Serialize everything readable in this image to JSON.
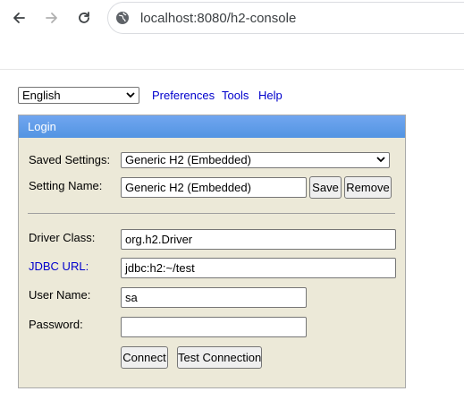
{
  "browser": {
    "url": "localhost:8080/h2-console"
  },
  "toolbar": {
    "language": "English",
    "links": [
      "Preferences",
      "Tools",
      "Help"
    ]
  },
  "login": {
    "title": "Login",
    "saved_settings_label": "Saved Settings:",
    "saved_settings_value": "Generic H2 (Embedded)",
    "setting_name_label": "Setting Name:",
    "setting_name_value": "Generic H2 (Embedded)",
    "save_label": "Save",
    "remove_label": "Remove",
    "driver_class_label": "Driver Class:",
    "driver_class_value": "org.h2.Driver",
    "jdbc_url_label": "JDBC URL:",
    "jdbc_url_value": "jdbc:h2:~/test",
    "user_name_label": "User Name:",
    "user_name_value": "sa",
    "password_label": "Password:",
    "password_value": "",
    "connect_label": "Connect",
    "test_connection_label": "Test Connection"
  },
  "colors": {
    "header_blue": "#5294e2",
    "panel_bg": "#ece9d8",
    "link_blue": "#0000cc"
  }
}
